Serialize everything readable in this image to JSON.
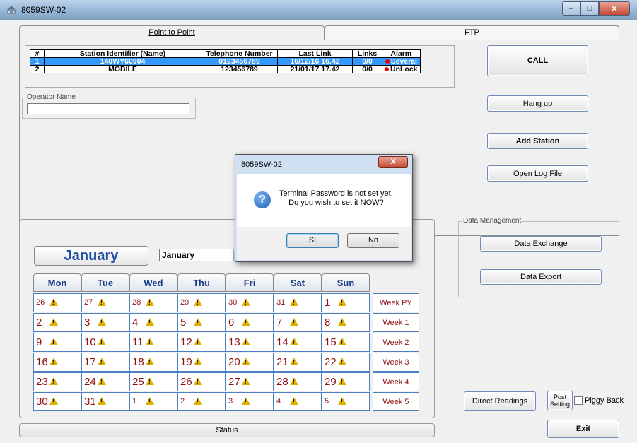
{
  "window": {
    "title": "8059SW-02"
  },
  "tabs": [
    {
      "label": "Point to Point"
    },
    {
      "label": "FTP"
    }
  ],
  "stations": {
    "headers": [
      "#",
      "Station Identifier (Name)",
      "Telephone Number",
      "Last Link",
      "Links",
      "Alarm"
    ],
    "rows": [
      {
        "num": "1",
        "name": "140WY60904",
        "phone": "0123456789",
        "last_link": "16/12/16 16.42",
        "links": "0/0",
        "alarm": "Several",
        "selected": true
      },
      {
        "num": "2",
        "name": "MOBILE",
        "phone": "123456789",
        "last_link": "21/01/17 17.42",
        "links": "0/0",
        "alarm": "UnLock",
        "selected": false
      }
    ]
  },
  "operator": {
    "label": "Operator Name",
    "value": ""
  },
  "buttons": {
    "call": "CALL",
    "hang_up": "Hang up",
    "add_station": "Add Station",
    "open_log": "Open Log File",
    "data_exchange": "Data Exchange",
    "data_export": "Data Export",
    "direct_readings": "Direct Readings",
    "post_setting_line1": "Post",
    "post_setting_line2": "Setting",
    "exit": "Exit"
  },
  "data_management": {
    "label": "Data Management"
  },
  "piggy_back": {
    "label": "Piggy Back",
    "checked": false
  },
  "calendar": {
    "month_title": "January",
    "month_select": "January",
    "days": [
      "Mon",
      "Tue",
      "Wed",
      "Thu",
      "Fri",
      "Sat",
      "Sun"
    ],
    "weeks": [
      {
        "label": "Week PY",
        "dates": [
          "26",
          "27",
          "28",
          "29",
          "30",
          "31",
          "1"
        ]
      },
      {
        "label": "Week 1",
        "dates": [
          "2",
          "3",
          "4",
          "5",
          "6",
          "7",
          "8"
        ]
      },
      {
        "label": "Week 2",
        "dates": [
          "9",
          "10",
          "11",
          "12",
          "13",
          "14",
          "15"
        ]
      },
      {
        "label": "Week 3",
        "dates": [
          "16",
          "17",
          "18",
          "19",
          "20",
          "21",
          "22"
        ]
      },
      {
        "label": "Week 4",
        "dates": [
          "23",
          "24",
          "25",
          "26",
          "27",
          "28",
          "29"
        ]
      },
      {
        "label": "Week 5",
        "dates": [
          "30",
          "31",
          "1",
          "2",
          "3",
          "4",
          "5"
        ]
      }
    ]
  },
  "status": {
    "label": "Status"
  },
  "dialog": {
    "title": "8059SW-02",
    "close": "X",
    "message": "Terminal Password is not set yet.\nDo you wish to set it NOW?",
    "yes": "Sì",
    "no": "No"
  },
  "colors": {
    "selection": "#3399ff",
    "date_text": "#8b1010",
    "month_title": "#1f4ea6"
  }
}
